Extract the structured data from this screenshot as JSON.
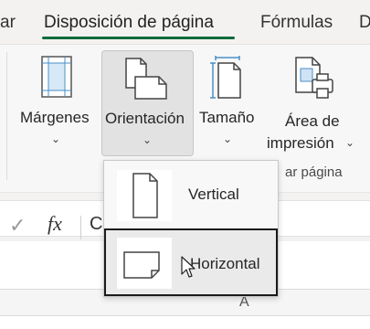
{
  "tabs": [
    {
      "label": "ar"
    },
    {
      "label": "Disposición de página"
    },
    {
      "label": "Fórmulas"
    },
    {
      "label": "D"
    }
  ],
  "ribbon": {
    "buttons": [
      {
        "label": "Márgenes",
        "icon": "margins-icon"
      },
      {
        "label": "Orientación",
        "icon": "orientation-icon"
      },
      {
        "label": "Tamaño",
        "icon": "page-size-icon"
      },
      {
        "label_line1": "Área de",
        "label_line2": "impresión",
        "icon": "print-area-icon"
      }
    ],
    "group_label": "ar página"
  },
  "formula_bar": {
    "input_text": "C"
  },
  "sheet": {
    "column_letter": "A"
  },
  "orientation_menu": {
    "items": [
      {
        "label": "Vertical",
        "icon": "portrait-page-icon"
      },
      {
        "label": "Horizontal",
        "icon": "landscape-page-icon",
        "selected": true
      }
    ]
  },
  "colors": {
    "accent_underline": "#0e6b3a",
    "ribbon_bg": "#f7f7f7",
    "pressed_bg": "#e2e2e2"
  }
}
